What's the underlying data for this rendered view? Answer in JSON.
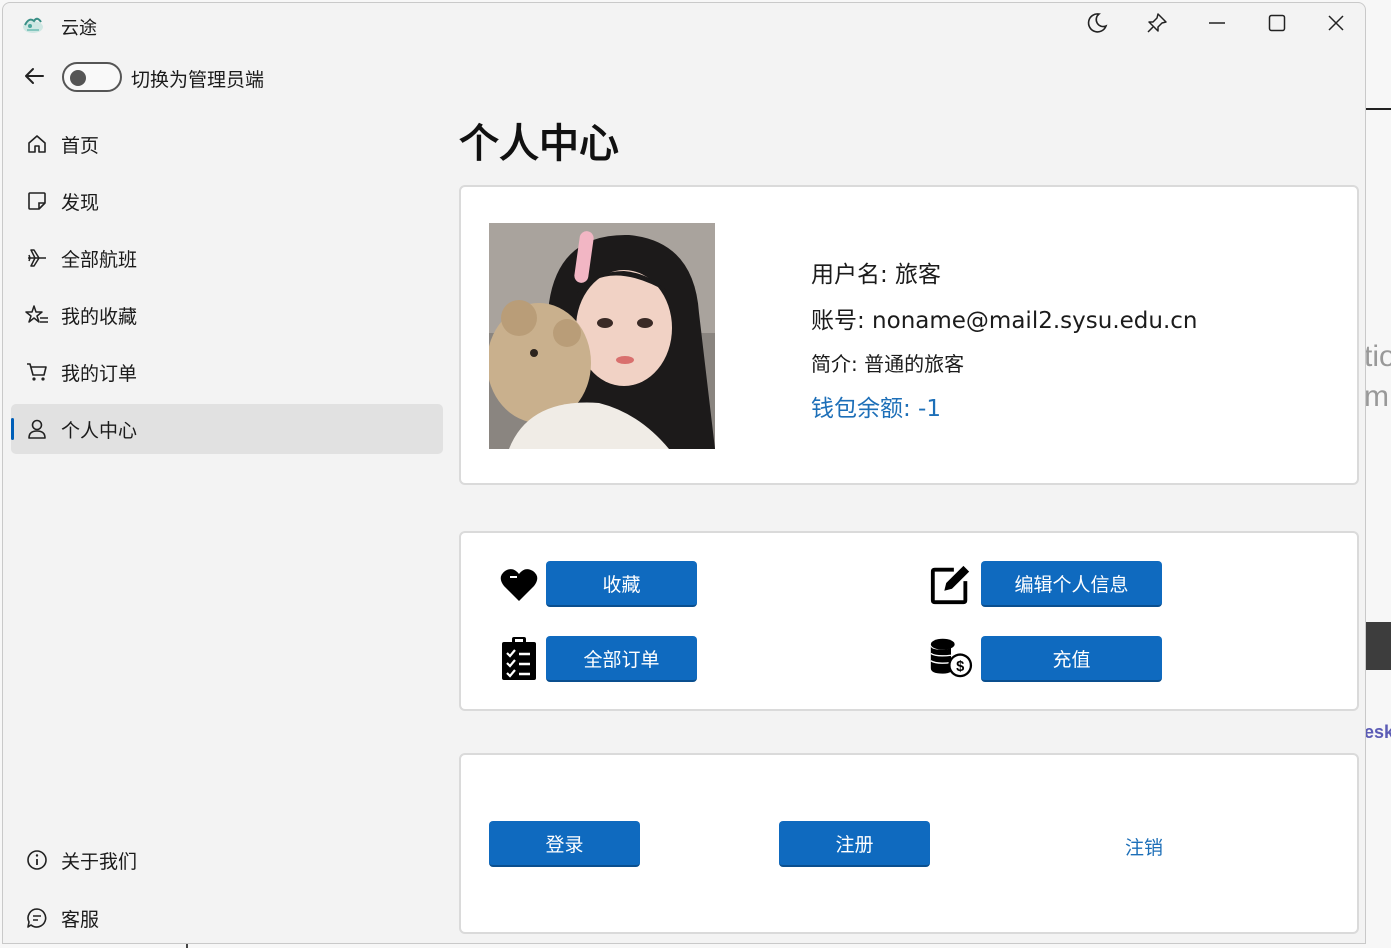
{
  "window": {
    "title": "云途"
  },
  "titlebar": {
    "buttons": [
      "moon-icon",
      "pin-icon",
      "minimize-icon",
      "maximize-icon",
      "close-icon"
    ]
  },
  "topbar": {
    "toggle_label": "切换为管理员端",
    "toggle_on": false
  },
  "sidebar": {
    "items": [
      {
        "label": "首页",
        "icon": "home-icon",
        "active": false
      },
      {
        "label": "发现",
        "icon": "note-icon",
        "active": false
      },
      {
        "label": "全部航班",
        "icon": "airplane-icon",
        "active": false
      },
      {
        "label": "我的收藏",
        "icon": "star-list-icon",
        "active": false
      },
      {
        "label": "我的订单",
        "icon": "cart-icon",
        "active": false
      },
      {
        "label": "个人中心",
        "icon": "person-icon",
        "active": true
      }
    ],
    "footer_items": [
      {
        "label": "关于我们",
        "icon": "info-icon"
      },
      {
        "label": "客服",
        "icon": "chat-icon"
      }
    ]
  },
  "page": {
    "title": "个人中心"
  },
  "profile": {
    "username": "用户名: 旅客",
    "account": "账号: noname@mail2.sysu.edu.cn",
    "bio": "简介: 普通的旅客",
    "wallet": "钱包余额: -1"
  },
  "actions": {
    "favorites": "收藏",
    "edit_profile": "编辑个人信息",
    "all_orders": "全部订单",
    "recharge": "充值"
  },
  "auth": {
    "login": "登录",
    "register": "注册",
    "logout": "注销"
  },
  "colors": {
    "accent": "#0f6abf",
    "link": "#1d6fb8",
    "window_bg": "#f3f3f3",
    "card_bg": "#ffffff"
  }
}
